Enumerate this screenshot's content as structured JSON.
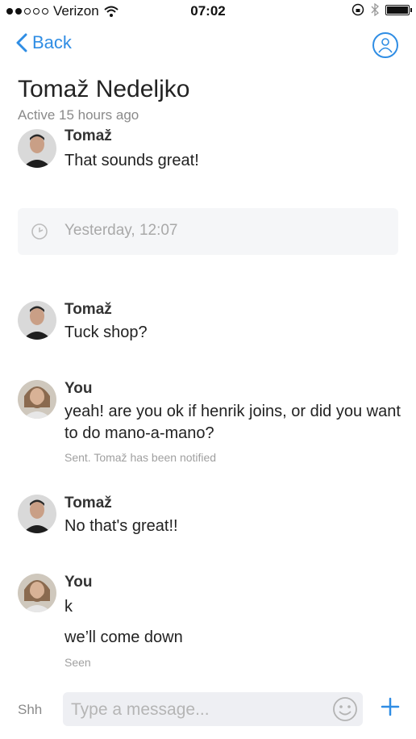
{
  "status": {
    "carrier": "Verizon",
    "time": "07:02"
  },
  "nav": {
    "back_label": "Back"
  },
  "header": {
    "title": "Tomaž Nedeljko",
    "subtitle": "Active 15 hours ago"
  },
  "conversation": {
    "messages": [
      {
        "sender": "Tomaž",
        "text": "That sounds great!"
      },
      {
        "timestamp": "Yesterday, 12:07"
      },
      {
        "sender": "Tomaž",
        "text": "Tuck shop?"
      },
      {
        "sender": "You",
        "text": "yeah! are you ok if henrik joins, or did you want to do mano-a-mano?",
        "meta": "Sent. Tomaž has been notified"
      },
      {
        "sender": "Tomaž",
        "text": "No that's great!!"
      },
      {
        "sender": "You",
        "text": "k",
        "text2": "we’ll come down",
        "meta": "Seen"
      }
    ]
  },
  "composer": {
    "shh_label": "Shh",
    "placeholder": "Type a message..."
  },
  "colors": {
    "accent": "#2f8de4"
  },
  "icons": {
    "back": "chevron-left-icon",
    "profile": "user-circle-icon",
    "clock": "clock-icon",
    "emoji": "smiley-icon",
    "add": "plus-icon"
  }
}
